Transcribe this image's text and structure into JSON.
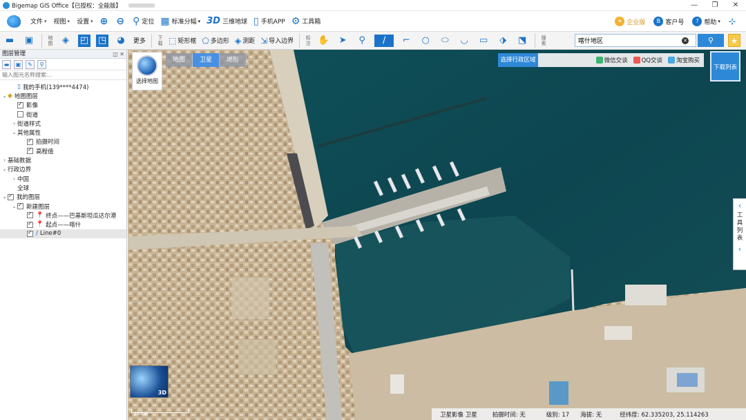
{
  "window": {
    "title": "Bigemap GIS Office【已授权：全能版】",
    "controls": [
      "—",
      "❐",
      "✕"
    ]
  },
  "menubar": {
    "menus": [
      {
        "label": "文件",
        "caret": "▾"
      },
      {
        "label": "视图",
        "caret": "▾"
      },
      {
        "label": "设置",
        "caret": "▾"
      }
    ],
    "tools": [
      {
        "icon": "⊕",
        "label": ""
      },
      {
        "icon": "⊖",
        "label": ""
      },
      {
        "icon": "⚲",
        "label": "定位"
      },
      {
        "icon": "▦",
        "label": "标准分幅",
        "caret": "▾"
      },
      {
        "icon": "3D",
        "label": "三维地球"
      },
      {
        "icon": "▯",
        "label": "手机APP"
      },
      {
        "icon": "⚙",
        "label": "工具箱"
      }
    ],
    "right": [
      {
        "icon": "✦",
        "label": "企业版"
      },
      {
        "icon": "B",
        "label": "客户号"
      },
      {
        "icon": "?",
        "label": "帮助",
        "caret": "▾"
      }
    ]
  },
  "toolbar": {
    "label_map": "地图",
    "label_download": "下载",
    "label_mark": "标注",
    "label_search": "搜索",
    "more": "更多",
    "rect_frame": "矩形框",
    "polygon": "多边形",
    "measure": "测距",
    "import_boundary": "导入边界",
    "search_value": "喀什地区",
    "search_button_icon": "⚲",
    "star_icon": "★"
  },
  "left_panel": {
    "title": "图层管理",
    "header_controls": "◫ ✕",
    "search_placeholder": "输入图元名称搜索...",
    "tree": [
      {
        "indent": 1,
        "arrow": "",
        "checkbox": null,
        "icon": "▯",
        "label": "我的手机(139****4474)"
      },
      {
        "indent": 0,
        "arrow": "⌄",
        "checkbox": null,
        "icon": "◆",
        "label": "地图图层"
      },
      {
        "indent": 1,
        "arrow": "",
        "checkbox": true,
        "icon": "",
        "label": "影像"
      },
      {
        "indent": 1,
        "arrow": "",
        "checkbox": false,
        "icon": "",
        "label": "街道"
      },
      {
        "indent": 1,
        "arrow": "›",
        "checkbox": null,
        "icon": "",
        "label": "街道样式"
      },
      {
        "indent": 1,
        "arrow": "⌄",
        "checkbox": null,
        "icon": "",
        "label": "其他属性"
      },
      {
        "indent": 2,
        "arrow": "",
        "checkbox": true,
        "icon": "",
        "label": "拍摄时间"
      },
      {
        "indent": 2,
        "arrow": "",
        "checkbox": true,
        "icon": "",
        "label": "高程值"
      },
      {
        "indent": 0,
        "arrow": "›",
        "checkbox": null,
        "icon": "",
        "label": "基础数据"
      },
      {
        "indent": 0,
        "arrow": "⌄",
        "checkbox": null,
        "icon": "",
        "label": "行政边界"
      },
      {
        "indent": 1,
        "arrow": "›",
        "checkbox": null,
        "icon": "",
        "label": "中国"
      },
      {
        "indent": 1,
        "arrow": "",
        "checkbox": null,
        "icon": "",
        "label": "全球"
      },
      {
        "indent": 0,
        "arrow": "⌄",
        "checkbox": true,
        "icon": "",
        "label": "我的图层"
      },
      {
        "indent": 1,
        "arrow": "⌄",
        "checkbox": true,
        "icon": "",
        "label": "新建图层"
      },
      {
        "indent": 2,
        "arrow": "",
        "checkbox": true,
        "icon": "📍",
        "label": "终点——巴基斯坦瓜达尔港"
      },
      {
        "indent": 2,
        "arrow": "",
        "checkbox": true,
        "icon": "📍",
        "label": "起点——喀什"
      },
      {
        "indent": 2,
        "arrow": "",
        "checkbox": true,
        "icon": "∕",
        "label": "Line#0",
        "selected": true
      }
    ]
  },
  "map": {
    "select_map": "选择地图",
    "tabs": [
      {
        "label": "地图",
        "active": false
      },
      {
        "label": "卫星",
        "active": true
      },
      {
        "label": "地形",
        "active": false
      }
    ],
    "region_select": "选择行政区域",
    "wechat": "微信交谈",
    "qq": "QQ交谈",
    "taobao": "淘宝购买",
    "download_list": "下载列表",
    "tool_list": [
      "工",
      "具",
      "列",
      "表"
    ],
    "minimap_tag": "3D",
    "scale": "200米",
    "status": {
      "mode": "卫星影像 卫星",
      "capture_time": "拍摄时间: 无",
      "level": "级别: 17",
      "altitude": "海拔: 无",
      "coords": "经纬度: 62.335203, 25.114263"
    }
  }
}
